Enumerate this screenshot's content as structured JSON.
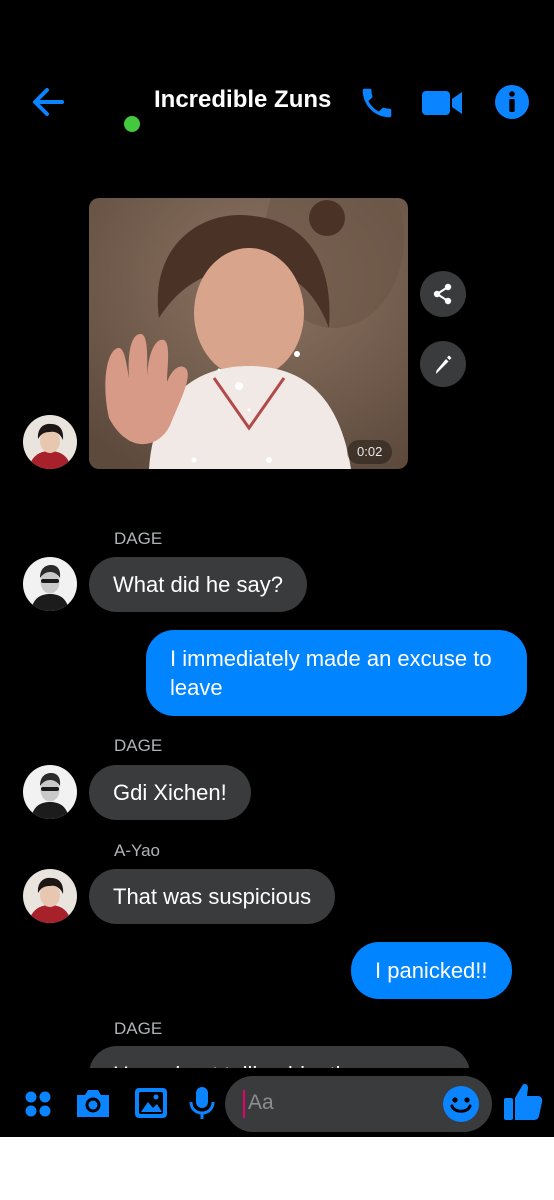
{
  "header": {
    "title": "Incredible Zuns",
    "online": true
  },
  "media": {
    "duration": "0:02"
  },
  "messages": [
    {
      "sender": "DAGE",
      "text": "What did he say?"
    },
    {
      "text": "I immediately made an excuse to leave"
    },
    {
      "sender": "DAGE",
      "text": "Gdi Xichen!"
    },
    {
      "sender": "A-Yao",
      "text": "That was suspicious"
    },
    {
      "text": "I panicked!!"
    },
    {
      "sender": "DAGE",
      "text": "How about telling him th..."
    }
  ],
  "composer": {
    "placeholder": "Aa"
  },
  "icons": {
    "back": "arrow-left-icon",
    "call": "phone-icon",
    "video": "video-camera-icon",
    "info": "info-icon",
    "share": "share-icon",
    "edit": "pencil-icon",
    "apps": "grid-icon",
    "camera": "camera-icon",
    "gallery": "image-icon",
    "mic": "microphone-icon",
    "emoji": "smiley-icon",
    "like": "thumbs-up-icon"
  },
  "colors": {
    "accent": "#0084ff",
    "incoming": "#3a3b3c",
    "online": "#44c83f",
    "background": "#000000"
  }
}
